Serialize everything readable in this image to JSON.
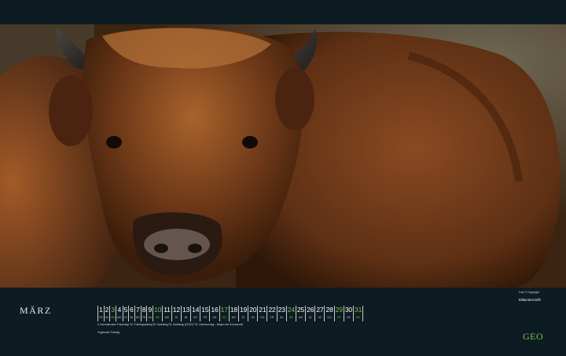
{
  "month": "MÄRZ",
  "days": [
    {
      "n": "1",
      "d": "FR",
      "green": false
    },
    {
      "n": "2",
      "d": "SA",
      "green": false
    },
    {
      "n": "3",
      "d": "SO",
      "green": true
    },
    {
      "n": "4",
      "d": "MO",
      "green": false
    },
    {
      "n": "5",
      "d": "DI",
      "green": false
    },
    {
      "n": "6",
      "d": "MI",
      "green": false
    },
    {
      "n": "7",
      "d": "DO",
      "green": false
    },
    {
      "n": "8",
      "d": "FR",
      "green": false
    },
    {
      "n": "9",
      "d": "SA",
      "green": false
    },
    {
      "n": "10",
      "d": "SO",
      "green": true
    },
    {
      "n": "11",
      "d": "MO",
      "green": false
    },
    {
      "n": "12",
      "d": "DI",
      "green": false
    },
    {
      "n": "13",
      "d": "MI",
      "green": false
    },
    {
      "n": "14",
      "d": "DO",
      "green": false
    },
    {
      "n": "15",
      "d": "FR",
      "green": false
    },
    {
      "n": "16",
      "d": "SA",
      "green": false
    },
    {
      "n": "17",
      "d": "SO",
      "green": true
    },
    {
      "n": "18",
      "d": "MO",
      "green": false
    },
    {
      "n": "19",
      "d": "DI",
      "green": false
    },
    {
      "n": "20",
      "d": "MI",
      "green": false
    },
    {
      "n": "21",
      "d": "DO",
      "green": false
    },
    {
      "n": "22",
      "d": "FR",
      "green": false
    },
    {
      "n": "23",
      "d": "SA",
      "green": false
    },
    {
      "n": "24",
      "d": "SO",
      "green": true
    },
    {
      "n": "25",
      "d": "MO",
      "green": false
    },
    {
      "n": "26",
      "d": "DI",
      "green": false
    },
    {
      "n": "27",
      "d": "MI",
      "green": false
    },
    {
      "n": "28",
      "d": "DO",
      "green": false
    },
    {
      "n": "29",
      "d": "FR",
      "green": true
    },
    {
      "n": "30",
      "d": "SA",
      "green": false
    },
    {
      "n": "31",
      "d": "SO",
      "green": true
    }
  ],
  "holidays": "8. Internationaler Frauentag*   20. Frühlingsanfang   29. Karfreitag   29. Karfreitag (ZKOG)*   31. Ostersonntag – Beginn der Sommerzeit",
  "footnote": "*regionaler Feiertag",
  "credit_line1": "Foto © Copyright",
  "credit_line2": "Bildunterschrift",
  "logo": "GEO",
  "colors": {
    "bar": "#0d1c22",
    "accent": "#7cc24a",
    "text": "#ffffff"
  }
}
